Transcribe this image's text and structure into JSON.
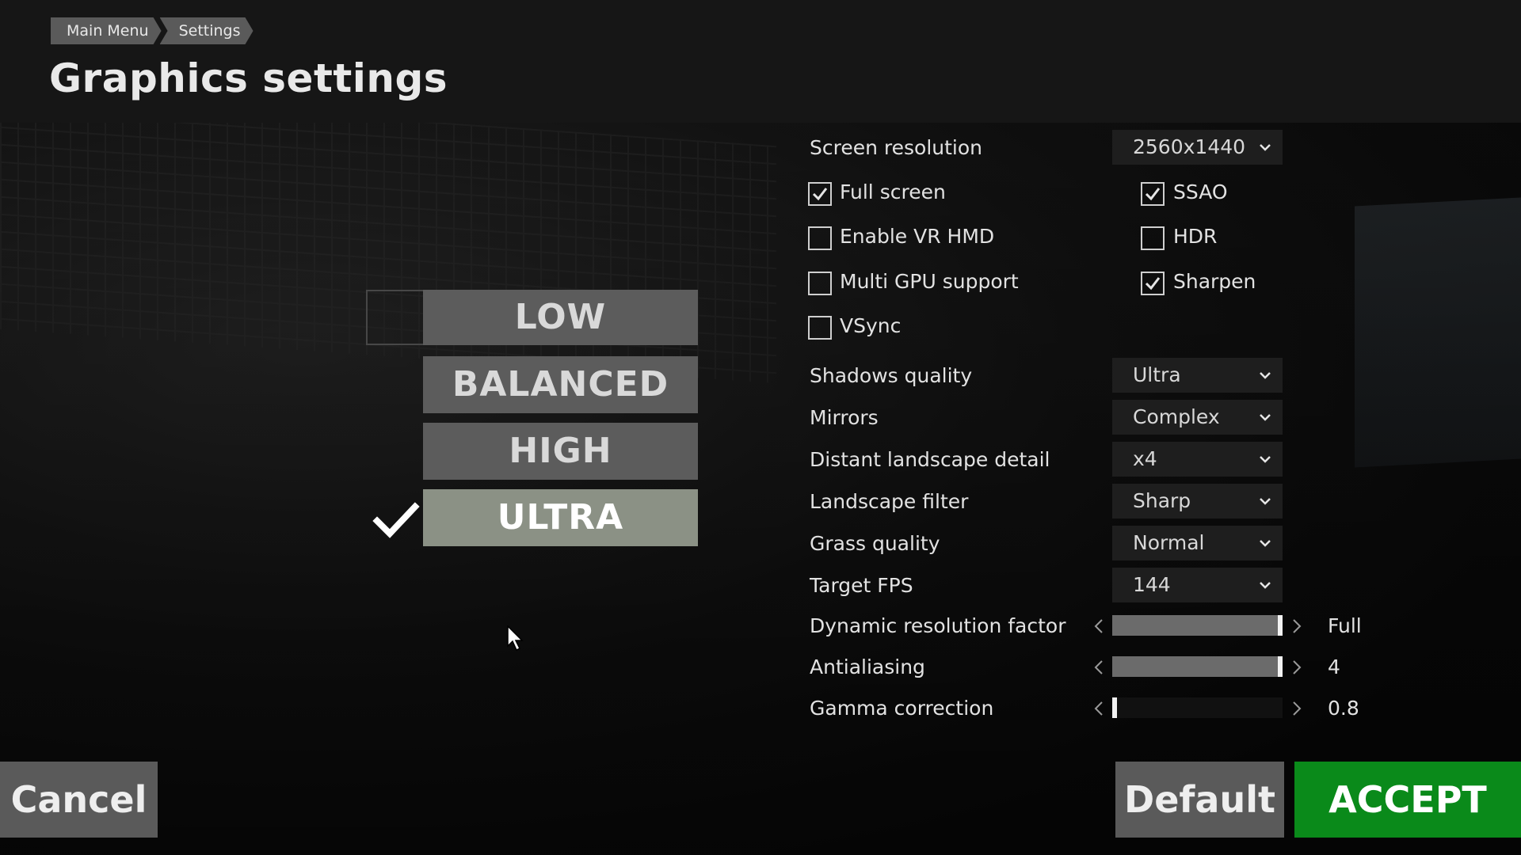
{
  "breadcrumb": {
    "items": [
      "Main Menu",
      "Settings"
    ]
  },
  "page": {
    "title": "Graphics settings"
  },
  "presets": {
    "items": [
      "LOW",
      "BALANCED",
      "HIGH",
      "ULTRA"
    ],
    "selected": "ULTRA"
  },
  "settings": {
    "screen_resolution": {
      "label": "Screen resolution",
      "value": "2560x1440"
    },
    "checkboxes": [
      {
        "label": "Full screen",
        "checked": true
      },
      {
        "label": "SSAO",
        "checked": true
      },
      {
        "label": "Enable VR HMD",
        "checked": false
      },
      {
        "label": "HDR",
        "checked": false
      },
      {
        "label": "Multi GPU support",
        "checked": false
      },
      {
        "label": "Sharpen",
        "checked": true
      },
      {
        "label": "VSync",
        "checked": false
      }
    ],
    "dropdowns": [
      {
        "label": "Shadows quality",
        "value": "Ultra"
      },
      {
        "label": "Mirrors",
        "value": "Complex"
      },
      {
        "label": "Distant landscape detail",
        "value": "x4"
      },
      {
        "label": "Landscape filter",
        "value": "Sharp"
      },
      {
        "label": "Grass quality",
        "value": "Normal"
      },
      {
        "label": "Target FPS",
        "value": "144"
      }
    ],
    "sliders": [
      {
        "label": "Dynamic resolution factor",
        "value": "Full",
        "level": 1.0
      },
      {
        "label": "Antialiasing",
        "value": "4",
        "level": 1.0
      },
      {
        "label": "Gamma correction",
        "value": "0.8",
        "level": 0.0
      }
    ]
  },
  "buttons": {
    "cancel": "Cancel",
    "default": "Default",
    "accept": "ACCEPT"
  },
  "colors": {
    "accept": "#0a8a1a",
    "preset_selected": "#8b9185",
    "button_gray": "#5a5a5a"
  }
}
